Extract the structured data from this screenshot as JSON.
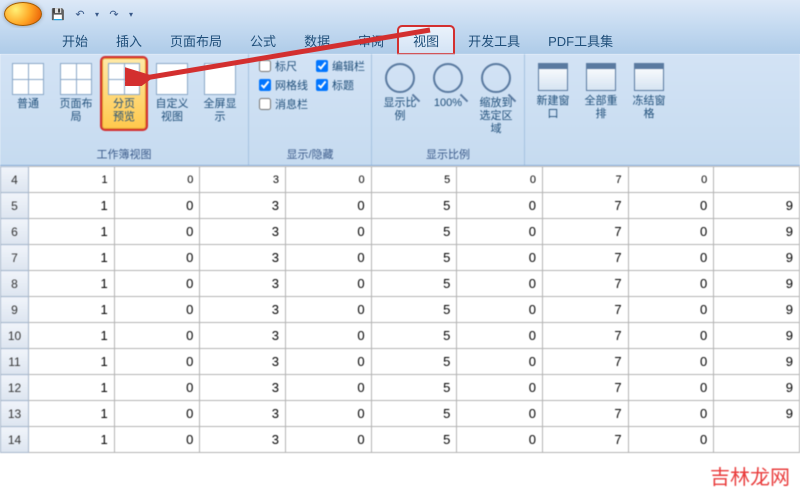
{
  "tabs": [
    "开始",
    "插入",
    "页面布局",
    "公式",
    "数据",
    "审阅",
    "视图",
    "开发工具",
    "PDF工具集"
  ],
  "active_tab_index": 6,
  "ribbon": {
    "group_view": {
      "label": "工作簿视图",
      "buttons": {
        "normal": "普通",
        "page_layout": "页面布局",
        "page_break": "分页\n预览",
        "custom": "自定义\n视图",
        "fullscreen": "全屏显示"
      }
    },
    "group_show": {
      "label": "显示/隐藏",
      "checks": {
        "ruler": "标尺",
        "gridlines": "网格线",
        "message_bar": "消息栏",
        "formula_bar": "编辑栏",
        "headings": "标题"
      },
      "checked": {
        "ruler": false,
        "gridlines": true,
        "message_bar": false,
        "formula_bar": true,
        "headings": true
      }
    },
    "group_zoom": {
      "label": "显示比例",
      "buttons": {
        "zoom": "显示比例",
        "hundred": "100%",
        "fit": "缩放到\n选定区域"
      }
    },
    "group_window": {
      "buttons": {
        "new_window": "新建窗口",
        "arrange_all": "全部重排",
        "freeze": "冻结窗格"
      }
    }
  },
  "chart_data": {
    "type": "table",
    "row_headers": [
      "4",
      "5",
      "6",
      "7",
      "8",
      "9",
      "10",
      "11",
      "12",
      "13",
      "14"
    ],
    "columns_visible": 8,
    "rows": [
      [
        1,
        0,
        3,
        0,
        5,
        0,
        7,
        0
      ],
      [
        1,
        0,
        3,
        0,
        5,
        0,
        7,
        0,
        9
      ],
      [
        1,
        0,
        3,
        0,
        5,
        0,
        7,
        0,
        9
      ],
      [
        1,
        0,
        3,
        0,
        5,
        0,
        7,
        0,
        9
      ],
      [
        1,
        0,
        3,
        0,
        5,
        0,
        7,
        0,
        9
      ],
      [
        1,
        0,
        3,
        0,
        5,
        0,
        7,
        0,
        9
      ],
      [
        1,
        0,
        3,
        0,
        5,
        0,
        7,
        0,
        9
      ],
      [
        1,
        0,
        3,
        0,
        5,
        0,
        7,
        0,
        9
      ],
      [
        1,
        0,
        3,
        0,
        5,
        0,
        7,
        0,
        9
      ],
      [
        1,
        0,
        3,
        0,
        5,
        0,
        7,
        0,
        9
      ],
      [
        1,
        0,
        3,
        0,
        5,
        0,
        7,
        0
      ]
    ]
  },
  "watermark": "吉林龙网"
}
